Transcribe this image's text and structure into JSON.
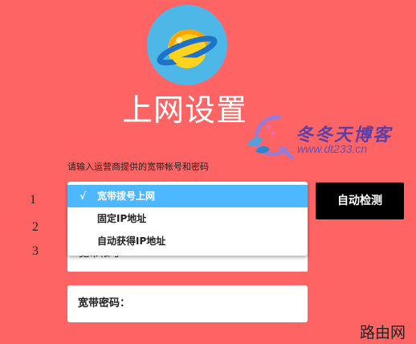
{
  "header": {
    "title": "上网设置"
  },
  "watermark": {
    "brand": "冬冬天博客",
    "url": "www.dt233.cn"
  },
  "form": {
    "hint": "请输入运营商提供的宽带帐号和密码",
    "row_numbers": [
      "1",
      "2",
      "3"
    ],
    "connection_type": {
      "options": [
        {
          "label": "宽带拨号上网",
          "selected": true,
          "check": "√"
        },
        {
          "label": "固定IP地址",
          "selected": false,
          "check": ""
        },
        {
          "label": "自动获得IP地址",
          "selected": false,
          "check": ""
        }
      ]
    },
    "account_label_partial": "宽带帐号",
    "auto_detect_button": "自动检测",
    "password_label": "宽带密码："
  },
  "footer": {
    "corner_text": "路由网"
  },
  "colors": {
    "background": "#ff6464",
    "accent": "#4db8ff",
    "button": "#000000",
    "logo": "#4db8e8"
  },
  "icons": {
    "logo": "planet-icon",
    "watermark": "flower-q-logo-icon"
  }
}
